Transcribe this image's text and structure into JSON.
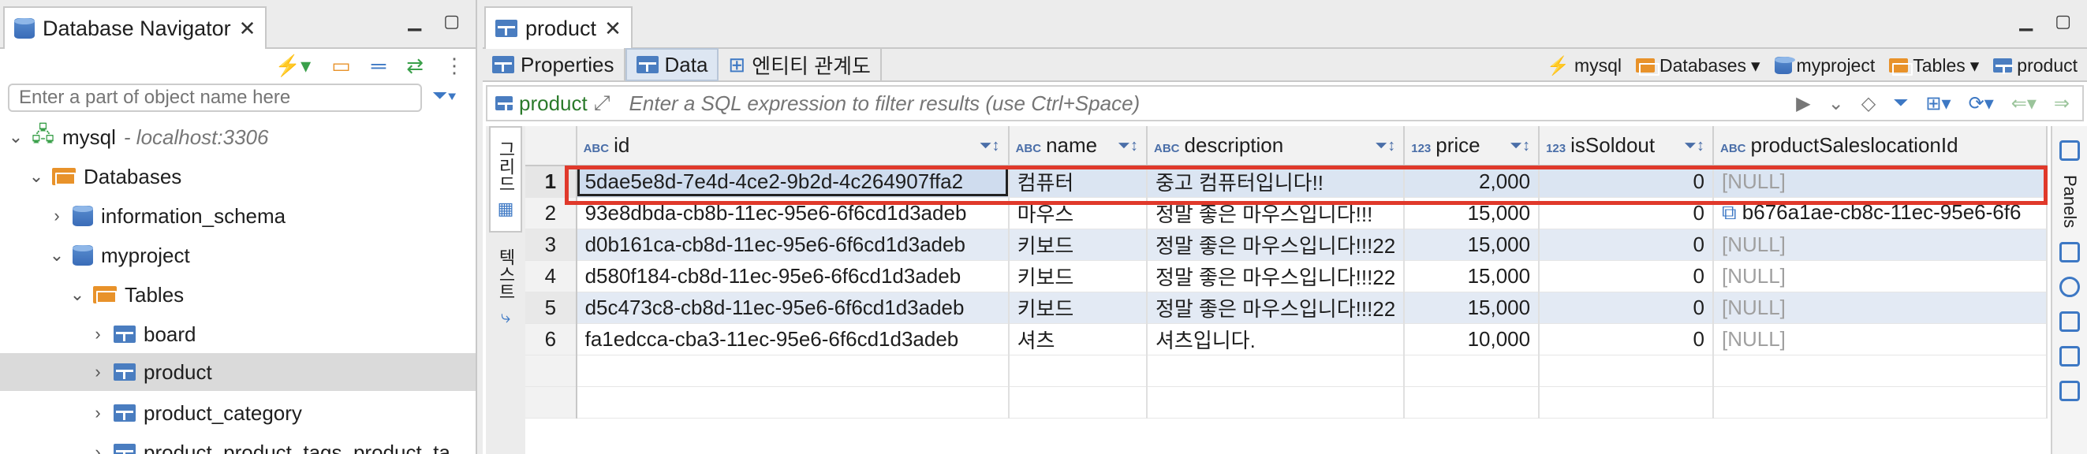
{
  "navigator": {
    "title": "Database Navigator",
    "search_placeholder": "Enter a part of object name here",
    "tree": [
      {
        "label": "mysql",
        "suffix": "- localhost:3306"
      },
      {
        "label": "Databases"
      },
      {
        "label": "information_schema"
      },
      {
        "label": "myproject"
      },
      {
        "label": "Tables"
      },
      {
        "label": "board"
      },
      {
        "label": "product"
      },
      {
        "label": "product_category"
      },
      {
        "label": "product_product_tags_product_ta"
      }
    ]
  },
  "editor": {
    "tab_title": "product",
    "subtabs": [
      "Properties",
      "Data",
      "엔티티 관계도"
    ],
    "breadcrumb": [
      "mysql",
      "Databases",
      "myproject",
      "Tables",
      "product"
    ],
    "filter_table": "product",
    "filter_placeholder": "Enter a SQL expression to filter results (use Ctrl+Space)",
    "side_tabs": [
      "그리드",
      "텍스트"
    ],
    "panels_label": "Panels",
    "columns": [
      {
        "type": "ABC",
        "name": "id"
      },
      {
        "type": "ABC",
        "name": "name"
      },
      {
        "type": "ABC",
        "name": "description"
      },
      {
        "type": "123",
        "name": "price"
      },
      {
        "type": "123",
        "name": "isSoldout"
      },
      {
        "type": "ABC",
        "name": "productSaleslocationId"
      }
    ],
    "rows": [
      {
        "n": "1",
        "id": "5dae5e8d-7e4d-4ce2-9b2d-4c264907ffa2",
        "name": "컴퓨터",
        "description": "중고 컴퓨터입니다!!",
        "price": "2,000",
        "isSoldout": "0",
        "loc": "[NULL]"
      },
      {
        "n": "2",
        "id": "93e8dbda-cb8b-11ec-95e6-6f6cd1d3adeb",
        "name": "마우스",
        "description": "정말 좋은 마우스입니다!!!",
        "price": "15,000",
        "isSoldout": "0",
        "loc": "b676a1ae-cb8c-11ec-95e6-6f6"
      },
      {
        "n": "3",
        "id": "d0b161ca-cb8d-11ec-95e6-6f6cd1d3adeb",
        "name": "키보드",
        "description": "정말 좋은 마우스입니다!!!22",
        "price": "15,000",
        "isSoldout": "0",
        "loc": "[NULL]"
      },
      {
        "n": "4",
        "id": "d580f184-cb8d-11ec-95e6-6f6cd1d3adeb",
        "name": "키보드",
        "description": "정말 좋은 마우스입니다!!!22",
        "price": "15,000",
        "isSoldout": "0",
        "loc": "[NULL]"
      },
      {
        "n": "5",
        "id": "d5c473c8-cb8d-11ec-95e6-6f6cd1d3adeb",
        "name": "키보드",
        "description": "정말 좋은 마우스입니다!!!22",
        "price": "15,000",
        "isSoldout": "0",
        "loc": "[NULL]"
      },
      {
        "n": "6",
        "id": "fa1edcca-cba3-11ec-95e6-6f6cd1d3adeb",
        "name": "셔츠",
        "description": "셔츠입니다.",
        "price": "10,000",
        "isSoldout": "0",
        "loc": "[NULL]"
      }
    ]
  },
  "colors": {
    "accent": "#4a7dc0",
    "highlight": "#e0392b",
    "selection": "#dbe5f2"
  }
}
